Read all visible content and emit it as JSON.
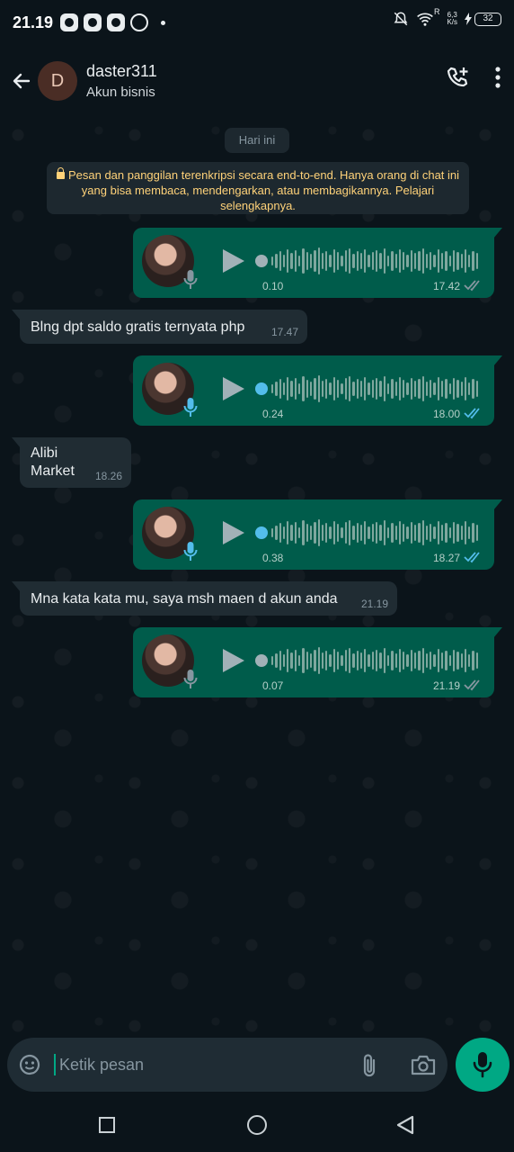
{
  "status_bar": {
    "time": "21.19",
    "speed_value": "6,3",
    "speed_unit": "K/s",
    "network_label": "R",
    "battery": "32"
  },
  "header": {
    "avatar_letter": "D",
    "contact_name": "daster311",
    "contact_sub": "Akun bisnis",
    "icons": [
      "back-arrow-icon",
      "add-call-icon",
      "more-vert-icon"
    ]
  },
  "chat": {
    "date_chip": "Hari ini",
    "encryption_notice": "Pesan dan panggilan terenkripsi secara end-to-end. Hanya orang di chat ini yang bisa membaca, mendengarkan, atau membagikannya. Pelajari selengkapnya.",
    "messages": [
      {
        "type": "voice",
        "direction": "out",
        "duration": "0.10",
        "time": "17.42",
        "played": false,
        "read_color": "#8696a0"
      },
      {
        "type": "text",
        "direction": "in",
        "text": "Blng dpt saldo gratis ternyata php",
        "time": "17.47"
      },
      {
        "type": "voice",
        "direction": "out",
        "duration": "0.24",
        "time": "18.00",
        "played": true,
        "read_color": "#53bdeb"
      },
      {
        "type": "text",
        "direction": "in",
        "text_line1": "Alibi",
        "text_line2": "Market",
        "time": "18.26"
      },
      {
        "type": "voice",
        "direction": "out",
        "duration": "0.38",
        "time": "18.27",
        "played": true,
        "read_color": "#53bdeb"
      },
      {
        "type": "text",
        "direction": "in",
        "text": "Mna kata kata mu, saya msh maen d akun anda",
        "time": "21.19"
      },
      {
        "type": "voice",
        "direction": "out",
        "duration": "0.07",
        "time": "21.19",
        "played": false,
        "read_color": "#8696a0"
      }
    ]
  },
  "composer": {
    "placeholder": "Ketik pesan",
    "icons": [
      "sticker-icon",
      "attach-icon",
      "camera-icon",
      "mic-icon"
    ]
  },
  "colors": {
    "background": "#0b141a",
    "outgoing_bubble": "#005c4b",
    "incoming_bubble": "#202c33",
    "accent": "#00a884",
    "read_tick": "#53bdeb"
  }
}
